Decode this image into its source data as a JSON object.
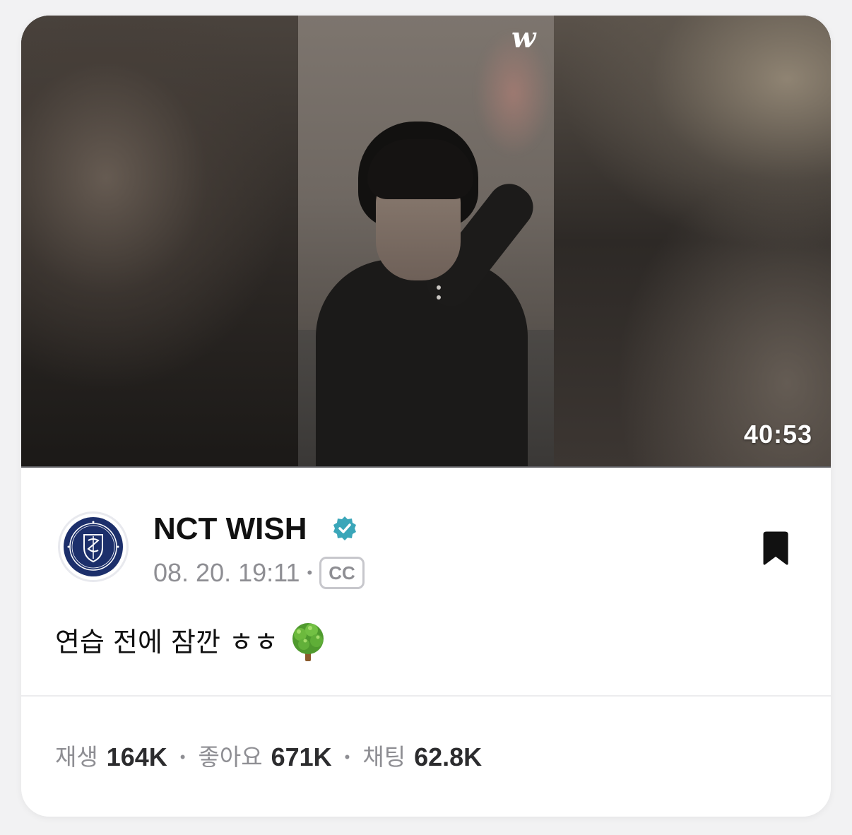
{
  "video": {
    "duration": "40:53",
    "logo_text": "w",
    "progress": 0
  },
  "channel": {
    "name": "NCT WISH",
    "verified_icon": "verified-badge-icon",
    "verified_color": "#3aa6b9",
    "avatar_icon": "nct-wish-crest-icon"
  },
  "post": {
    "date": "08. 20. 19:11",
    "meta_separator": "•",
    "cc_label": "CC",
    "caption": "연습 전에 잠깐 ㅎㅎ",
    "caption_emoji": "deciduous-tree-emoji",
    "bookmark_icon": "bookmark-icon"
  },
  "stats": {
    "separator": "•",
    "plays_label": "재생",
    "plays_value": "164K",
    "likes_label": "좋아요",
    "likes_value": "671K",
    "chats_label": "채팅",
    "chats_value": "62.8K"
  },
  "colors": {
    "accent": "#3aa6b9",
    "text_primary": "#111111",
    "text_secondary": "#8e8e93"
  }
}
